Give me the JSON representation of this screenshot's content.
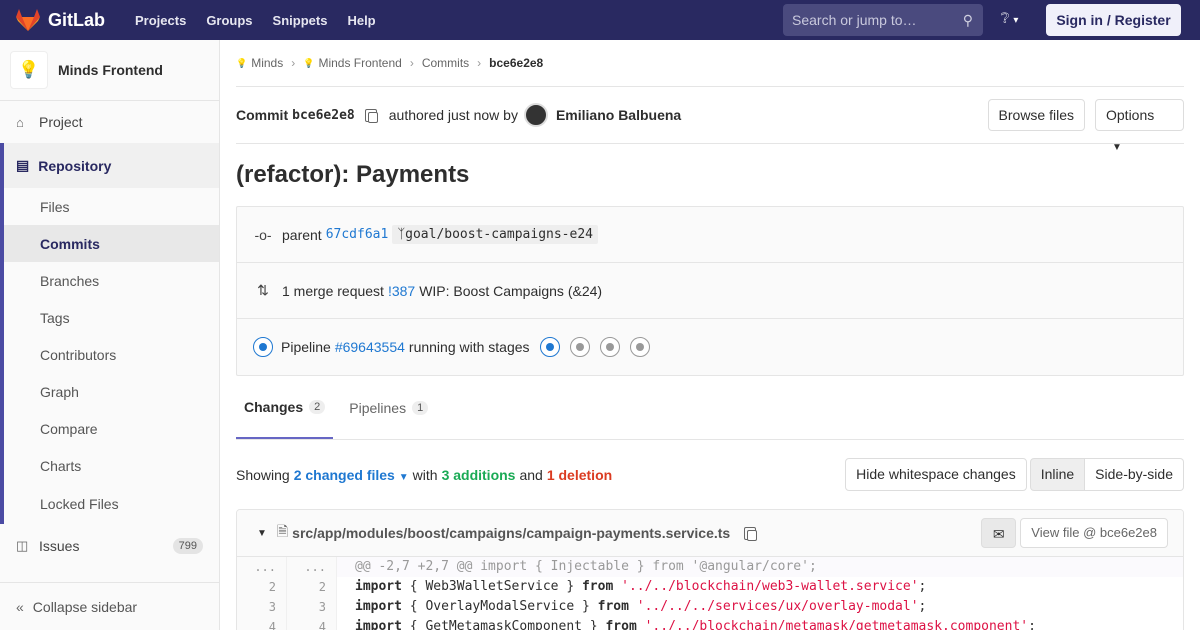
{
  "topnav": {
    "brand": "GitLab",
    "links": [
      "Projects",
      "Groups",
      "Snippets",
      "Help"
    ],
    "search_placeholder": "Search or jump to…",
    "help_icon": "question-icon",
    "signin_label": "Sign in / Register"
  },
  "sidebar": {
    "project_name": "Minds Frontend",
    "project_link": "Project",
    "repository": "Repository",
    "repo_items": [
      "Files",
      "Commits",
      "Branches",
      "Tags",
      "Contributors",
      "Graph",
      "Compare",
      "Charts",
      "Locked Files"
    ],
    "active_item": "Commits",
    "issues_label": "Issues",
    "issues_count": "799",
    "collapse_label": "Collapse sidebar"
  },
  "breadcrumb": [
    "Minds",
    "Minds Frontend",
    "Commits",
    "bce6e2e8"
  ],
  "commit": {
    "prefix": "Commit",
    "sha": "bce6e2e8",
    "authored": "authored just now by",
    "author": "Emiliano Balbuena",
    "browse_files": "Browse files",
    "options": "Options",
    "title": "(refactor): Payments",
    "parent_label": "parent",
    "parent_sha": "67cdf6a1",
    "branch": "goal/boost-campaigns-e24",
    "mr_text": "1 merge request",
    "mr_id": "!387",
    "mr_title": "WIP: Boost Campaigns (&24)",
    "pipeline_label": "Pipeline",
    "pipeline_id": "#69643554",
    "pipeline_status": "running with stages"
  },
  "tabs": [
    {
      "label": "Changes",
      "count": "2"
    },
    {
      "label": "Pipelines",
      "count": "1"
    }
  ],
  "diffstats": {
    "showing": "Showing",
    "files": "2 changed files",
    "with": "with",
    "additions": "3 additions",
    "and": "and",
    "deletions": "1 deletion",
    "hide_ws": "Hide whitespace changes",
    "inline": "Inline",
    "side": "Side-by-side"
  },
  "file": {
    "path": "src/app/modules/boost/campaigns/campaign-payments.service.ts",
    "view_file": "View file @ bce6e2e8",
    "hunk": "@@ -2,7 +2,7 @@ import { Injectable } from '@angular/core';",
    "lines": [
      {
        "old": "2",
        "new": "2",
        "a": "import",
        "b": " { Web3WalletService } ",
        "c": "from",
        "d": " '../../blockchain/web3-wallet.service'",
        "e": ";"
      },
      {
        "old": "3",
        "new": "3",
        "a": "import",
        "b": " { OverlayModalService } ",
        "c": "from",
        "d": " '../../../services/ux/overlay-modal'",
        "e": ";"
      },
      {
        "old": "4",
        "new": "4",
        "a": "import",
        "b": " { GetMetamaskComponent } ",
        "c": "from",
        "d": " '../../blockchain/metamask/getmetamask.component'",
        "e": ";"
      }
    ]
  }
}
